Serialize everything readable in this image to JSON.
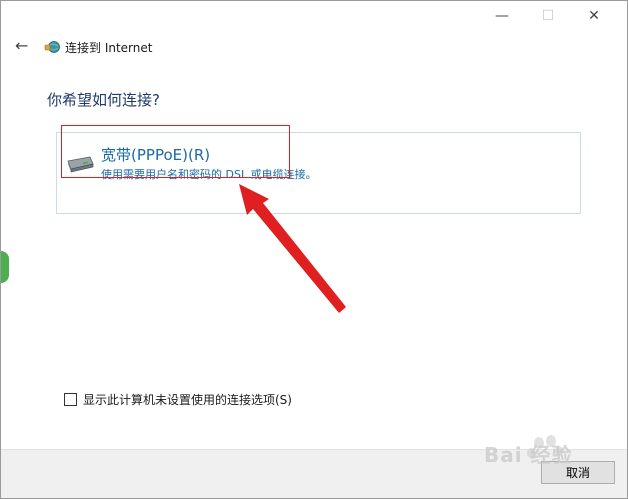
{
  "window": {
    "controls": {
      "minimize": "—",
      "maximize": "☐",
      "close": "✕"
    }
  },
  "header": {
    "back_icon": "←",
    "title": "连接到 Internet"
  },
  "main": {
    "question": "你希望如何连接?",
    "option": {
      "title": "宽带(PPPoE)(R)",
      "description": "使用需要用户名和密码的 DSL 或电缆连接。"
    }
  },
  "checkbox": {
    "label": "显示此计算机未设置使用的连接选项(S)",
    "checked": false
  },
  "footer": {
    "cancel_label": "取消"
  },
  "watermark": {
    "text": "Bai 经验"
  },
  "colors": {
    "accent": "#1a6aa6",
    "heading": "#1f3a6b",
    "annotation": "#e02020",
    "panel_border": "#c9dce9",
    "footer_bg": "#f0f0f0"
  }
}
